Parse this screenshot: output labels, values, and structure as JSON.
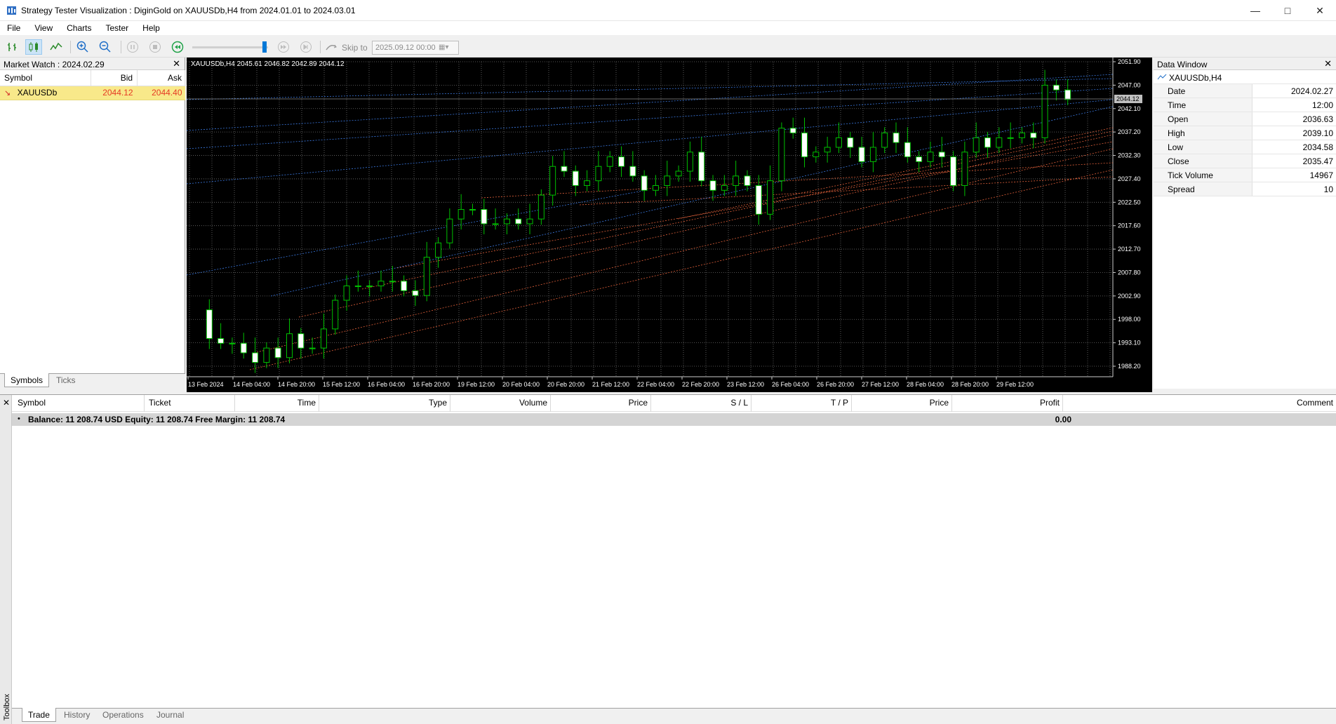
{
  "window": {
    "title": "Strategy Tester Visualization : DiginGold on XAUUSDb,H4 from 2024.01.01 to 2024.03.01",
    "controls": [
      "minimize",
      "maximize",
      "close"
    ]
  },
  "menu": [
    "File",
    "View",
    "Charts",
    "Tester",
    "Help"
  ],
  "toolbar": {
    "skip_label": "Skip to",
    "skip_value": "2025.09.12 00:00"
  },
  "market_watch": {
    "title": "Market Watch : 2024.02.29",
    "columns": [
      "Symbol",
      "Bid",
      "Ask"
    ],
    "rows": [
      {
        "symbol": "XAUUSDb",
        "bid": "2044.12",
        "ask": "2044.40"
      }
    ],
    "tabs": [
      "Symbols",
      "Ticks"
    ]
  },
  "chart": {
    "header": "XAUUSDb,H4  2045.61 2046.82 2042.89 2044.12",
    "current_price": "2044.12",
    "price_labels": [
      "2051.90",
      "2047.00",
      "2042.10",
      "2037.20",
      "2032.30",
      "2027.40",
      "2022.50",
      "2017.60",
      "2012.70",
      "2007.80",
      "2002.90",
      "1998.00",
      "1993.10",
      "1988.20"
    ],
    "time_labels": [
      "13 Feb 2024",
      "14 Feb 04:00",
      "14 Feb 20:00",
      "15 Feb 12:00",
      "16 Feb 04:00",
      "16 Feb 20:00",
      "19 Feb 12:00",
      "20 Feb 04:00",
      "20 Feb 20:00",
      "21 Feb 12:00",
      "22 Feb 04:00",
      "22 Feb 20:00",
      "23 Feb 12:00",
      "26 Feb 04:00",
      "26 Feb 20:00",
      "27 Feb 12:00",
      "28 Feb 04:00",
      "28 Feb 20:00",
      "29 Feb 12:00"
    ],
    "colors": {
      "background": "#000000",
      "bull": "#00c000",
      "bear": "#ffffff",
      "grid": "#6e6e6e",
      "sell_line": "#e0603a",
      "buy_line": "#3a78e0"
    }
  },
  "data_window": {
    "title": "Data Window",
    "symbol": "XAUUSDb,H4",
    "rows": [
      {
        "key": "Date",
        "value": "2024.02.27"
      },
      {
        "key": "Time",
        "value": "12:00"
      },
      {
        "key": "Open",
        "value": "2036.63"
      },
      {
        "key": "High",
        "value": "2039.10"
      },
      {
        "key": "Low",
        "value": "2034.58"
      },
      {
        "key": "Close",
        "value": "2035.47"
      },
      {
        "key": "Tick Volume",
        "value": "14967"
      },
      {
        "key": "Spread",
        "value": "10"
      }
    ]
  },
  "toolbox": {
    "label": "Toolbox",
    "columns": [
      "Symbol",
      "Ticket",
      "Time",
      "Type",
      "Volume",
      "Price",
      "S / L",
      "T / P",
      "Price",
      "Profit",
      "Comment"
    ],
    "balance_text": "Balance: 11 208.74 USD  Equity: 11 208.74  Free Margin: 11 208.74",
    "profit": "0.00",
    "tabs": [
      "Trade",
      "History",
      "Operations",
      "Journal"
    ]
  }
}
